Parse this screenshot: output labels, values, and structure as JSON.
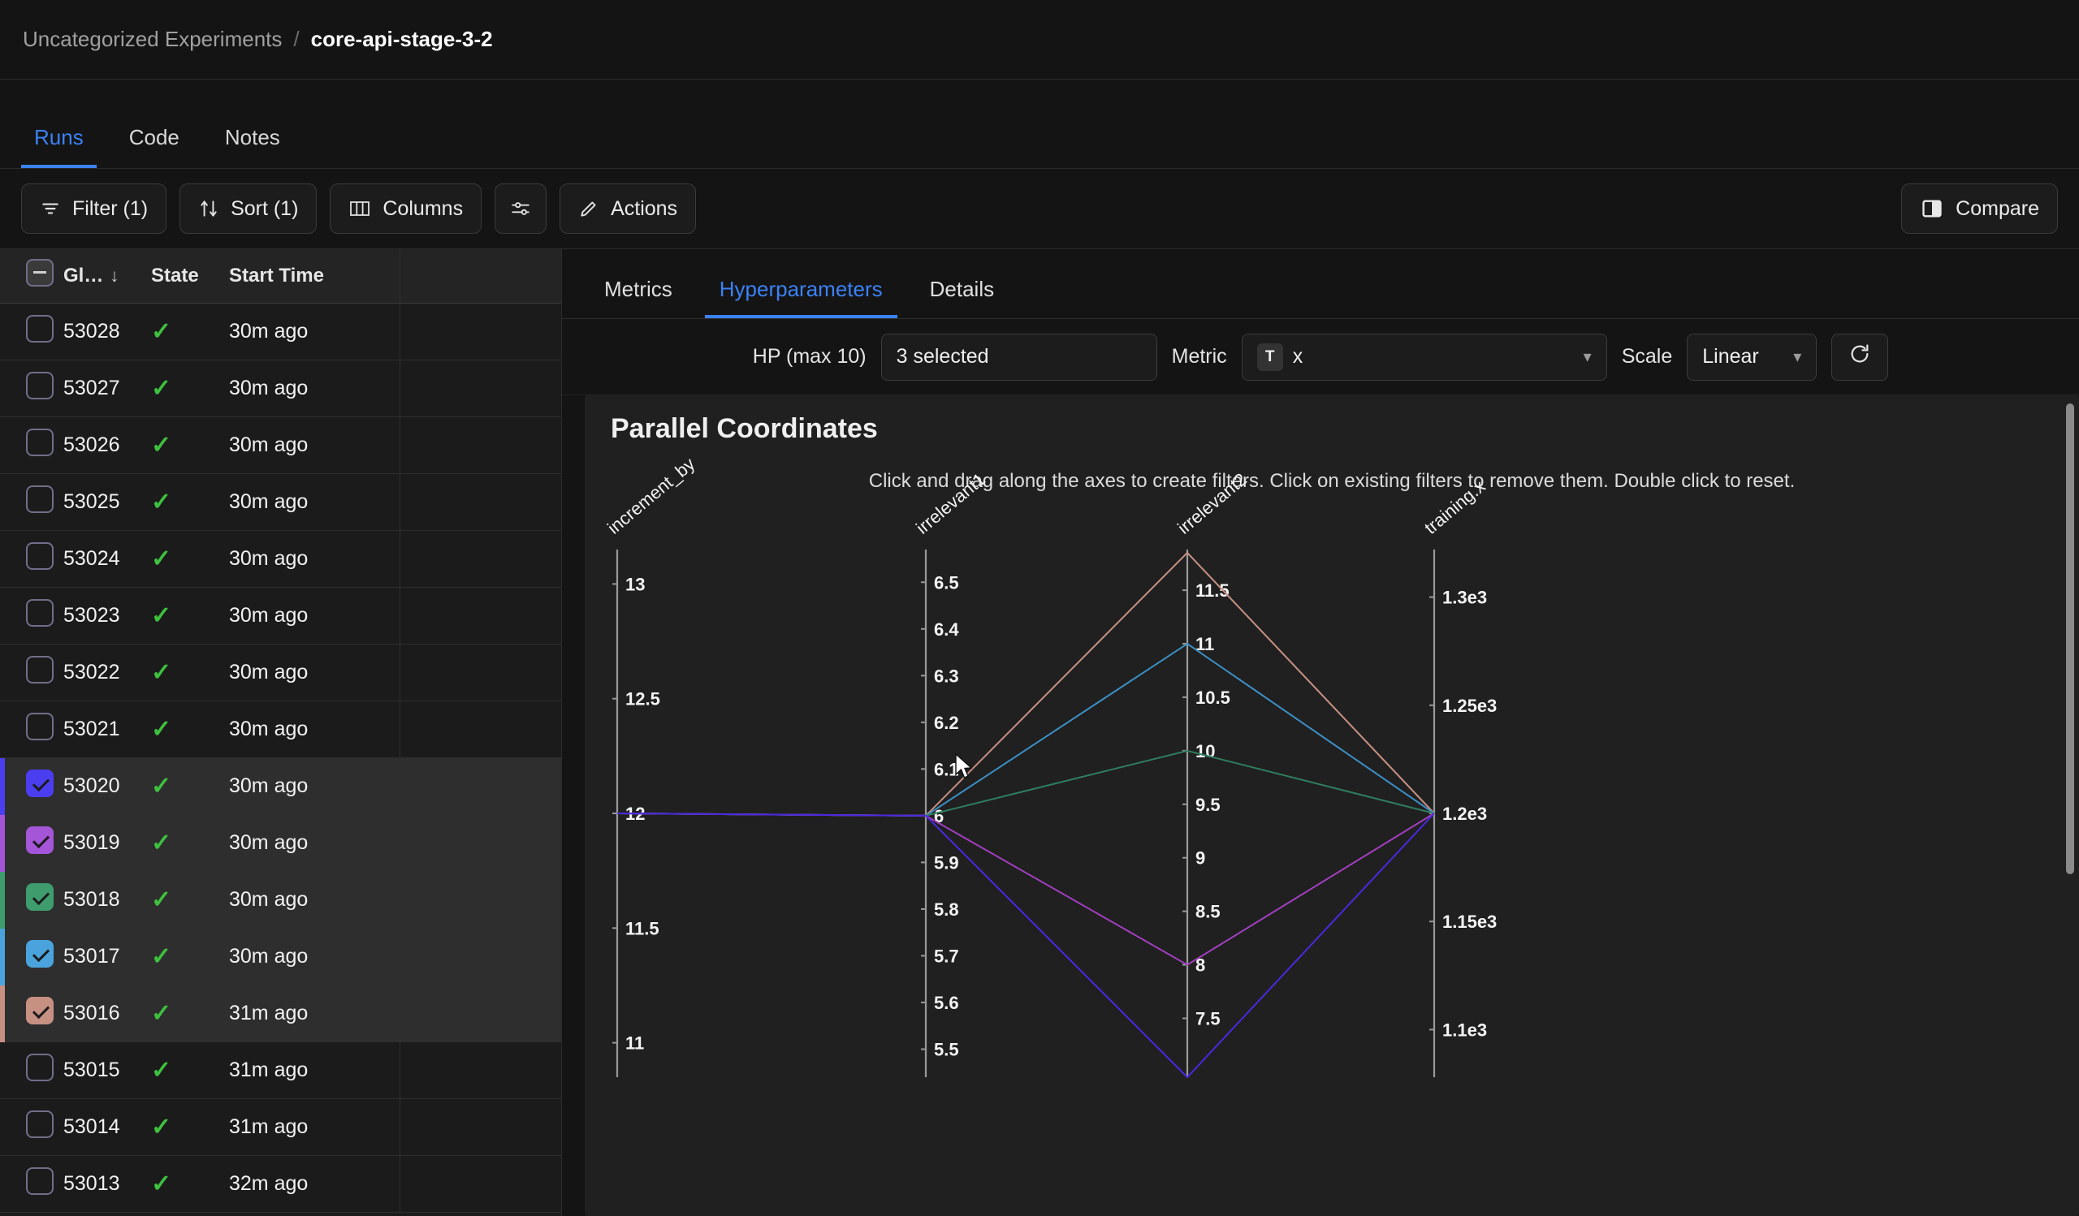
{
  "breadcrumb": {
    "root": "Uncategorized Experiments",
    "separator": "/",
    "leaf": "core-api-stage-3-2"
  },
  "page_tabs": [
    {
      "label": "Runs",
      "active": true
    },
    {
      "label": "Code",
      "active": false
    },
    {
      "label": "Notes",
      "active": false
    }
  ],
  "toolbar": {
    "filter_label": "Filter (1)",
    "sort_label": "Sort (1)",
    "columns_label": "Columns",
    "settings_label": "",
    "actions_label": "Actions",
    "compare_label": "Compare"
  },
  "runs_table": {
    "headers": {
      "select": "",
      "id": "Gl…",
      "sort_caret": "↓",
      "state": "State",
      "start_time": "Start Time",
      "extra": ""
    },
    "rows": [
      {
        "id": "53028",
        "state": "✓",
        "start_time": "30m ago",
        "selected": false,
        "color": null
      },
      {
        "id": "53027",
        "state": "✓",
        "start_time": "30m ago",
        "selected": false,
        "color": null
      },
      {
        "id": "53026",
        "state": "✓",
        "start_time": "30m ago",
        "selected": false,
        "color": null
      },
      {
        "id": "53025",
        "state": "✓",
        "start_time": "30m ago",
        "selected": false,
        "color": null
      },
      {
        "id": "53024",
        "state": "✓",
        "start_time": "30m ago",
        "selected": false,
        "color": null
      },
      {
        "id": "53023",
        "state": "✓",
        "start_time": "30m ago",
        "selected": false,
        "color": null
      },
      {
        "id": "53022",
        "state": "✓",
        "start_time": "30m ago",
        "selected": false,
        "color": null
      },
      {
        "id": "53021",
        "state": "✓",
        "start_time": "30m ago",
        "selected": false,
        "color": null
      },
      {
        "id": "53020",
        "state": "✓",
        "start_time": "30m ago",
        "selected": true,
        "color": "#4b3ef0"
      },
      {
        "id": "53019",
        "state": "✓",
        "start_time": "30m ago",
        "selected": true,
        "color": "#a555d8"
      },
      {
        "id": "53018",
        "state": "✓",
        "start_time": "30m ago",
        "selected": true,
        "color": "#3e9c6d"
      },
      {
        "id": "53017",
        "state": "✓",
        "start_time": "30m ago",
        "selected": true,
        "color": "#4aa3dd"
      },
      {
        "id": "53016",
        "state": "✓",
        "start_time": "31m ago",
        "selected": true,
        "color": "#c69083"
      },
      {
        "id": "53015",
        "state": "✓",
        "start_time": "31m ago",
        "selected": false,
        "color": null
      },
      {
        "id": "53014",
        "state": "✓",
        "start_time": "31m ago",
        "selected": false,
        "color": null
      },
      {
        "id": "53013",
        "state": "✓",
        "start_time": "32m ago",
        "selected": false,
        "color": null
      }
    ]
  },
  "viz_tabs": [
    {
      "label": "Metrics",
      "active": false
    },
    {
      "label": "Hyperparameters",
      "active": true
    },
    {
      "label": "Details",
      "active": false
    }
  ],
  "controls": {
    "hp_label": "HP (max 10)",
    "hp_value": "3 selected",
    "metric_label": "Metric",
    "metric_type_chip": "T",
    "metric_value": "x",
    "scale_label": "Scale",
    "scale_value": "Linear",
    "refresh_icon": "refresh-icon"
  },
  "chart_data": {
    "type": "parallel-coordinates",
    "title": "Parallel Coordinates",
    "subtitle": "Click and drag along the axes to create filters. Click on existing filters to remove them. Double click to reset.",
    "axes": [
      {
        "name": "increment_by",
        "ticks": [
          "13",
          "12.5",
          "12",
          "11.5",
          "11"
        ],
        "tick_values": [
          13,
          12.5,
          12,
          11.5,
          11
        ],
        "domain": [
          10.85,
          13.15
        ]
      },
      {
        "name": "irrelevant1",
        "ticks": [
          "6.5",
          "6.4",
          "6.3",
          "6.2",
          "6.1",
          "6",
          "5.9",
          "5.8",
          "5.7",
          "5.6",
          "5.5"
        ],
        "tick_values": [
          6.5,
          6.4,
          6.3,
          6.2,
          6.1,
          6.0,
          5.9,
          5.8,
          5.7,
          5.6,
          5.5
        ],
        "domain": [
          5.44,
          6.57
        ]
      },
      {
        "name": "irrelevant2",
        "ticks": [
          "11.5",
          "11",
          "10.5",
          "10",
          "9.5",
          "9",
          "8.5",
          "8",
          "7.5"
        ],
        "tick_values": [
          11.5,
          11,
          10.5,
          10,
          9.5,
          9,
          8.5,
          8,
          7.5
        ],
        "domain": [
          6.95,
          11.88
        ]
      },
      {
        "name": "training.x",
        "ticks": [
          "1.3e3",
          "1.25e3",
          "1.2e3",
          "1.15e3",
          "1.1e3"
        ],
        "tick_values": [
          1300,
          1250,
          1200,
          1150,
          1100
        ],
        "domain": [
          1078,
          1322
        ]
      }
    ],
    "series": [
      {
        "name": "53016",
        "color": "#c69083",
        "values": [
          12,
          6,
          11.85,
          1200
        ]
      },
      {
        "name": "53017",
        "color": "#3c8fc4",
        "values": [
          12,
          6,
          11.0,
          1200
        ]
      },
      {
        "name": "53018",
        "color": "#2f7d5e",
        "values": [
          12,
          6,
          10.0,
          1200
        ]
      },
      {
        "name": "53019",
        "color": "#a23fc0",
        "values": [
          12,
          6,
          8.0,
          1200
        ]
      },
      {
        "name": "53020",
        "color": "#4b28e0",
        "values": [
          12,
          6,
          6.95,
          1200
        ]
      }
    ]
  }
}
